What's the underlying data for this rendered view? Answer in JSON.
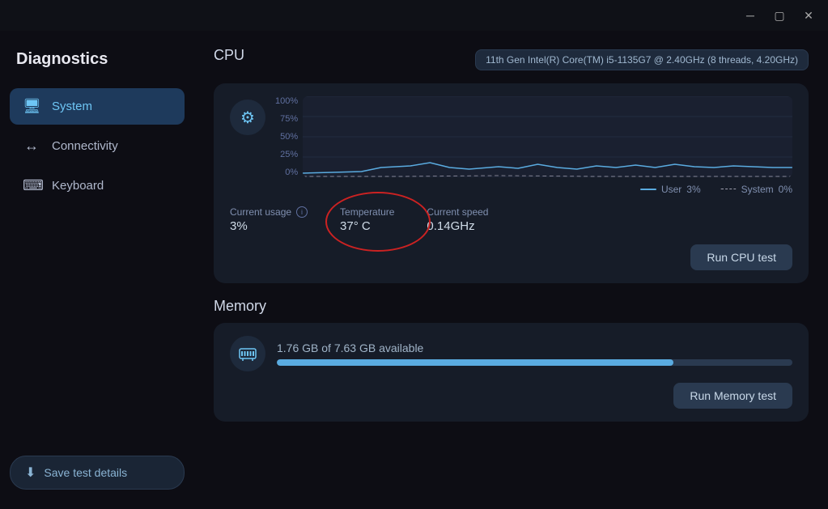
{
  "app": {
    "title": "Diagnostics"
  },
  "titlebar": {
    "minimize_label": "─",
    "maximize_label": "▢",
    "close_label": "✕"
  },
  "sidebar": {
    "items": [
      {
        "id": "system",
        "label": "System",
        "icon": "🖥",
        "active": true
      },
      {
        "id": "connectivity",
        "label": "Connectivity",
        "icon": "↔",
        "active": false
      },
      {
        "id": "keyboard",
        "label": "Keyboard",
        "icon": "⌨",
        "active": false
      }
    ],
    "save_button_label": "Save test details"
  },
  "cpu": {
    "section_label": "CPU",
    "chip_info": "11th Gen Intel(R) Core(TM) i5-1135G7 @ 2.40GHz (8 threads, 4.20GHz)",
    "chart_labels": [
      "100%",
      "75%",
      "50%",
      "25%",
      "0%"
    ],
    "legend": [
      {
        "id": "user",
        "label": "User",
        "value": "3%",
        "color": "#5aabe0"
      },
      {
        "id": "system",
        "label": "System",
        "value": "0%",
        "color": "#a0a0b0"
      }
    ],
    "stats": [
      {
        "id": "current_usage",
        "label": "Current usage",
        "value": "3%",
        "has_info": true
      },
      {
        "id": "temperature",
        "label": "Temperature",
        "value": "37° C",
        "highlighted": true
      },
      {
        "id": "current_speed",
        "label": "Current speed",
        "value": "0.14GHz",
        "highlighted": false
      }
    ],
    "run_test_label": "Run CPU test"
  },
  "memory": {
    "section_label": "Memory",
    "usage_text": "1.76 GB of 7.63 GB available",
    "bar_percent": 77,
    "run_test_label": "Run Memory test"
  }
}
